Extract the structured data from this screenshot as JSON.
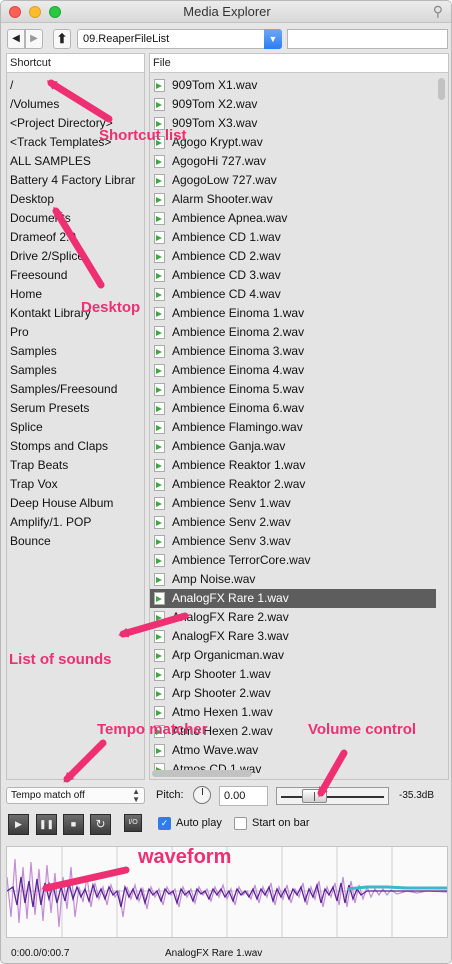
{
  "window": {
    "title": "Media Explorer"
  },
  "toolbar": {
    "back_glyph": "◀",
    "forward_glyph": "▶",
    "up_glyph": "⬆",
    "path": "09.ReaperFileList",
    "dropdown_glyph": "▼",
    "search_value": ""
  },
  "shortcut_panel": {
    "header": "Shortcut",
    "items": [
      "/",
      "/Volumes",
      "<Project Directory>",
      "<Track Templates>",
      "ALL SAMPLES",
      "Battery 4 Factory Librar",
      "Desktop",
      "Documents",
      "Drameof 2.0",
      "Drive 2/Splice",
      "Freesound",
      "Home",
      "Kontakt Library",
      "Pro",
      "Samples",
      "Samples",
      "Samples/Freesound",
      "Serum Presets",
      "Splice",
      "Stomps and Claps",
      "Trap Beats",
      "Trap Vox",
      "Deep House Album",
      "Amplify/1. POP",
      "Bounce"
    ]
  },
  "file_panel": {
    "header": "File",
    "items": [
      "909Tom X1.wav",
      "909Tom X2.wav",
      "909Tom X3.wav",
      "Agogo Krypt.wav",
      "AgogoHi 727.wav",
      "AgogoLow 727.wav",
      "Alarm Shooter.wav",
      "Ambience Apnea.wav",
      "Ambience CD 1.wav",
      "Ambience CD 2.wav",
      "Ambience CD 3.wav",
      "Ambience CD 4.wav",
      "Ambience Einoma 1.wav",
      "Ambience Einoma 2.wav",
      "Ambience Einoma 3.wav",
      "Ambience Einoma 4.wav",
      "Ambience Einoma 5.wav",
      "Ambience Einoma 6.wav",
      "Ambience Flamingo.wav",
      "Ambience Ganja.wav",
      "Ambience Reaktor 1.wav",
      "Ambience Reaktor 2.wav",
      "Ambience Senv 1.wav",
      "Ambience Senv 2.wav",
      "Ambience Senv 3.wav",
      "Ambience TerrorCore.wav",
      "Amp Noise.wav",
      "AnalogFX Rare 1.wav",
      "AnalogFX Rare 2.wav",
      "AnalogFX Rare 3.wav",
      "Arp Organicman.wav",
      "Arp Shooter 1.wav",
      "Arp Shooter 2.wav",
      "Atmo Hexen 1.wav",
      "Atmo Hexen 2.wav",
      "Atmo Wave.wav",
      "Atmos CD 1.wav"
    ],
    "selected_index": 27
  },
  "controls": {
    "tempo_match": "Tempo match off",
    "pitch_label": "Pitch:",
    "pitch_value": "0.00",
    "volume_level": 0.28,
    "volume_readout": "-35.3dB",
    "play_glyph": "▶",
    "pause_glyph": "❚❚",
    "stop_glyph": "■",
    "loop_glyph": "↻",
    "io_label": "I/O",
    "autoplay_label": "Auto play",
    "autoplay_checked": true,
    "checkmark": "✓",
    "start_on_bar_label": "Start on bar",
    "start_on_bar_checked": false
  },
  "status": {
    "time": "0:00.0/0:00.7",
    "file": "AnalogFX Rare 1.wav"
  },
  "annotations": {
    "shortcut_list": "Shortcut list",
    "desktop": "Desktop",
    "list_of_sounds": "List of sounds",
    "tempo_matcher": "Tempo matcher",
    "volume_control": "Volume control",
    "waveform": "waveform"
  },
  "colors": {
    "annotation": "#ee2f72",
    "selection": "#5d5d5d",
    "accent": "#2f7cf0",
    "waveform_teal": "#3fb6c9",
    "waveform_purple": "#6b2aa8"
  }
}
